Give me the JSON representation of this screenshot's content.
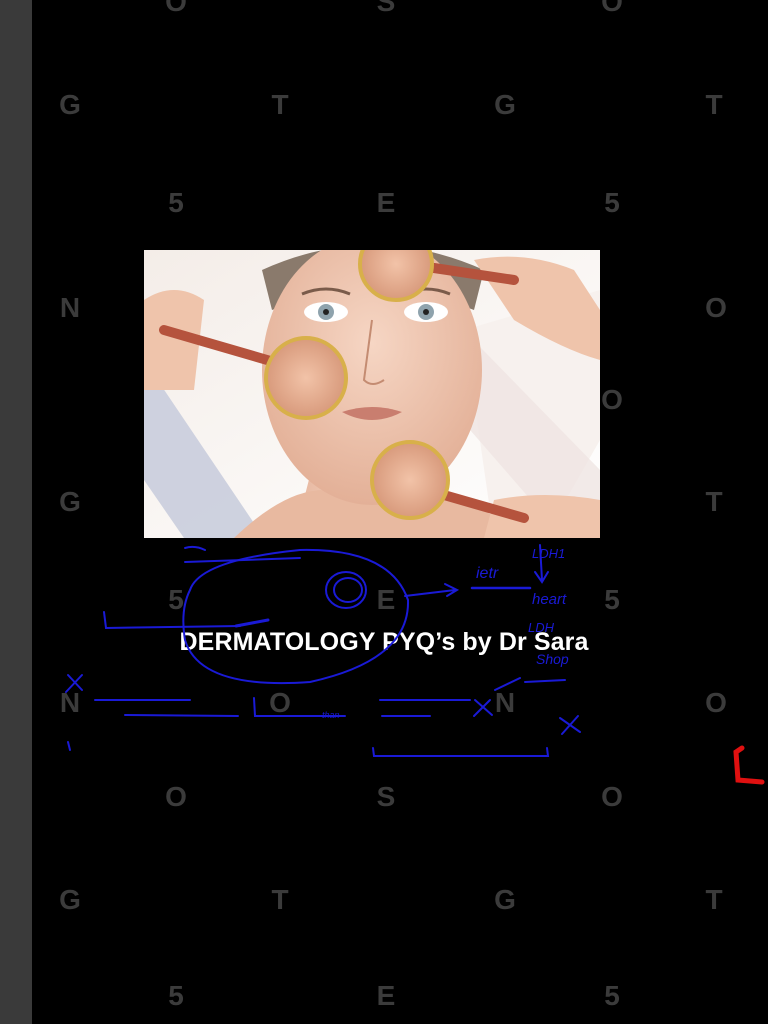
{
  "slide": {
    "title": "DERMATOLOGY PYQ’s by Dr Sara"
  },
  "watermark": {
    "rows": [
      [
        "O",
        "S",
        "O"
      ],
      [
        "G",
        "T",
        "G",
        "T"
      ],
      [
        "5",
        "E",
        "5"
      ],
      [
        "N",
        "O"
      ],
      [
        "O"
      ],
      [
        "G",
        "T"
      ],
      [
        "5",
        "E",
        "5"
      ],
      [
        "N",
        "O",
        "N",
        "O"
      ],
      [
        "O",
        "S",
        "O"
      ],
      [
        "G",
        "T",
        "G",
        "T"
      ],
      [
        "5",
        "E",
        "5"
      ]
    ]
  },
  "annotations": {
    "ink_color": "#1a1ad6",
    "marker_color": "#e01010",
    "handwritten_notes": [
      "ietr",
      "LDH1",
      "heart",
      "LDH",
      "Shop",
      "than"
    ]
  },
  "colors": {
    "background": "#000000",
    "left_strip": "#3a3a3a",
    "watermark": "#3b3b3b",
    "title": "#ffffff"
  }
}
